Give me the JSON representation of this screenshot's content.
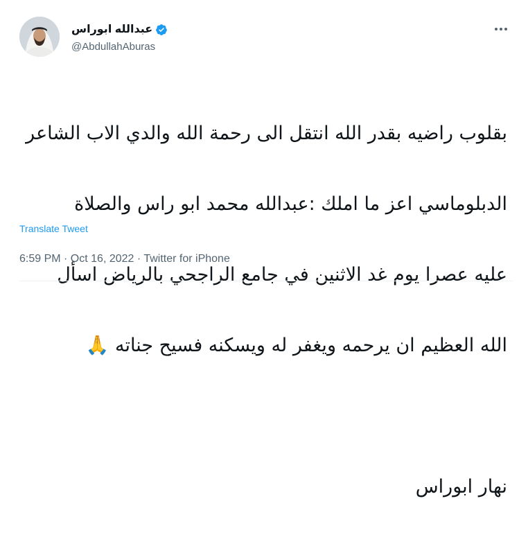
{
  "tweet": {
    "author": {
      "display_name": "عبدالله ابوراس",
      "handle": "@AbdullahAburas",
      "verified": true
    },
    "icons": {
      "verified": "verified-badge-icon",
      "more": "more-options-icon"
    },
    "body_lines": [
      "بقلوب راضيه بقدر الله انتقل الى رحمة الله والدي الاب الشاعر",
      "الدبلوماسي اعز ما املك :عبدالله محمد ابو راس والصلاة",
      "عليه عصرا يوم غد الاثنين في جامع الراجحي بالرياض اسأل",
      "الله العظيم ان يرحمه ويغفر له ويسكنه فسيح جناته 🙏",
      "",
      "نهار ابوراس"
    ],
    "translate_label": "Translate Tweet",
    "meta": "6:59 PM · Oct 16, 2022 · Twitter for iPhone"
  },
  "colors": {
    "accent": "#1d9bf0",
    "secondary_text": "#536471",
    "primary_text": "#0f1419"
  }
}
